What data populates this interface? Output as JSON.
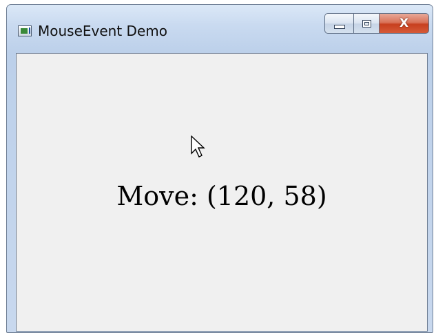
{
  "window": {
    "title": "MouseEvent Demo",
    "app_icon": "window-app-icon",
    "controls": {
      "minimize_icon": "minimize-icon",
      "maximize_icon": "maximize-icon",
      "close_symbol": "X"
    }
  },
  "content": {
    "event_label": "Move:",
    "readout": "Move: (120, 58)",
    "pointer_icon": "arrow-cursor-icon"
  },
  "colors": {
    "client_background": "#f0f0f0",
    "close_button": "#c7401f",
    "text": "#000000"
  }
}
